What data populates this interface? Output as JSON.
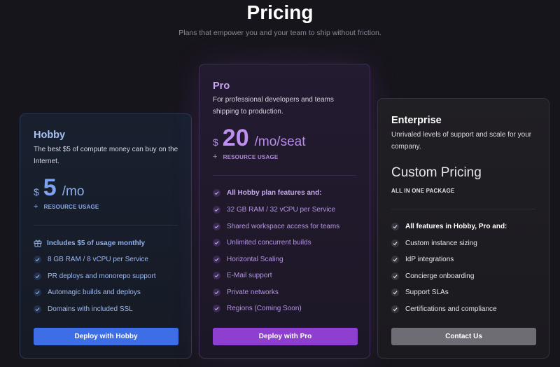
{
  "header": {
    "title": "Pricing",
    "subtitle": "Plans that empower you and your team to ship without friction."
  },
  "colors": {
    "hobby_accent": "#3d6ee6",
    "pro_accent": "#8e3fd0",
    "enterprise_button": "#6e6c75",
    "hobby_text": "#9cb6ee",
    "pro_text": "#b695e6"
  },
  "plans": {
    "hobby": {
      "name": "Hobby",
      "description": "The best $5 of compute money can buy on the Internet.",
      "currency": "$",
      "amount": "5",
      "unit": "/mo",
      "resource_label": "RESOURCE USAGE",
      "features": [
        "Includes $5 of usage monthly",
        "8 GB RAM / 8 vCPU per Service",
        "PR deploys and monorepo support",
        "Automagic builds and deploys",
        "Domains with included SSL"
      ],
      "cta": "Deploy with Hobby"
    },
    "pro": {
      "name": "Pro",
      "description": "For professional developers and teams shipping to production.",
      "currency": "$",
      "amount": "20",
      "unit": "/mo/seat",
      "resource_label": "RESOURCE USAGE",
      "features": [
        "All Hobby plan features and:",
        "32 GB RAM / 32 vCPU per Service",
        "Shared workspace access for teams",
        "Unlimited concurrent builds",
        "Horizontal Scaling",
        "E-Mail support",
        "Private networks",
        "Regions (Coming Soon)"
      ],
      "cta": "Deploy with Pro"
    },
    "enterprise": {
      "name": "Enterprise",
      "description": "Unrivaled levels of support and scale for your company.",
      "price_text": "Custom Pricing",
      "package_label": "ALL IN ONE PACKAGE",
      "features": [
        "All features in Hobby, Pro and:",
        "Custom instance sizing",
        "IdP integrations",
        "Concierge onboarding",
        "Support SLAs",
        "Certifications and compliance"
      ],
      "cta": "Contact Us"
    }
  }
}
